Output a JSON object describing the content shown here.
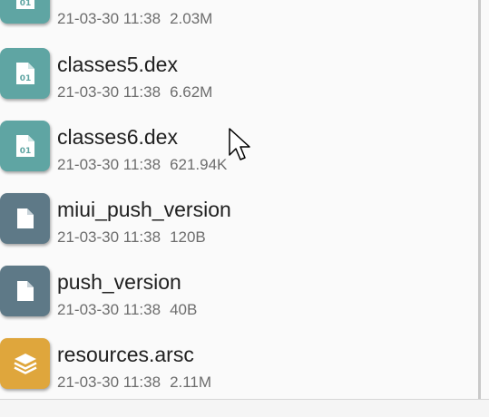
{
  "colors": {
    "dex_icon_bg": "#5fa5a3",
    "file_icon_bg": "#5e7987",
    "arsc_icon_bg": "#dfa63c"
  },
  "files": [
    {
      "icon": "dex-file-icon",
      "name": "",
      "date": "21-03-30 11:38",
      "size": "2.03M"
    },
    {
      "icon": "dex-file-icon",
      "name": "classes5.dex",
      "date": "21-03-30 11:38",
      "size": "6.62M"
    },
    {
      "icon": "dex-file-icon",
      "name": "classes6.dex",
      "date": "21-03-30 11:38",
      "size": "621.94K"
    },
    {
      "icon": "generic-file-icon",
      "name": "miui_push_version",
      "date": "21-03-30 11:38",
      "size": "120B"
    },
    {
      "icon": "generic-file-icon",
      "name": "push_version",
      "date": "21-03-30 11:38",
      "size": "40B"
    },
    {
      "icon": "layers-file-icon",
      "name": "resources.arsc",
      "date": "21-03-30 11:38",
      "size": "2.11M"
    }
  ]
}
